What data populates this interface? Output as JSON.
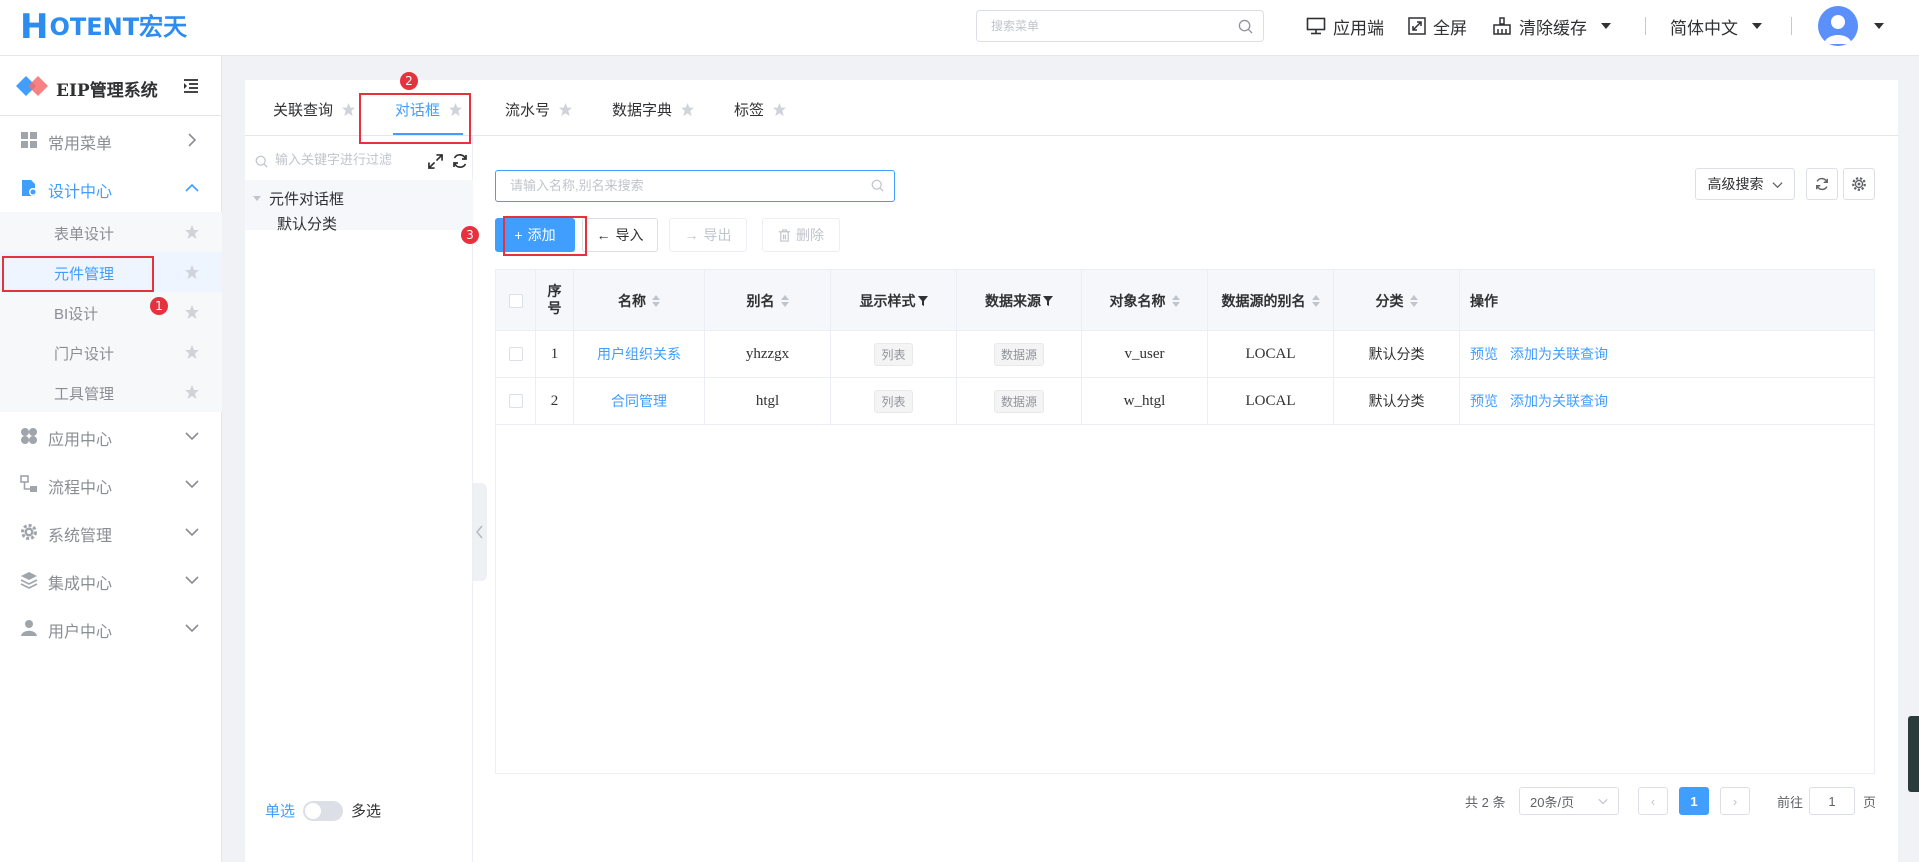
{
  "header": {
    "logo_h": "H",
    "logo_text": "OTENT宏天",
    "search_placeholder": "搜索菜单",
    "app_label": "应用端",
    "fullscreen_label": "全屏",
    "clear_cache_label": "清除缓存",
    "language_label": "简体中文"
  },
  "sidebar": {
    "system_name": "EIP管理系统",
    "menu": [
      {
        "label": "常用菜单"
      },
      {
        "label": "设计中心"
      },
      {
        "label": "应用中心"
      },
      {
        "label": "流程中心"
      },
      {
        "label": "系统管理"
      },
      {
        "label": "集成中心"
      },
      {
        "label": "用户中心"
      }
    ],
    "design_sub": [
      {
        "label": "表单设计"
      },
      {
        "label": "元件管理"
      },
      {
        "label": "BI设计"
      },
      {
        "label": "门户设计"
      },
      {
        "label": "工具管理"
      }
    ]
  },
  "tabs": [
    {
      "label": "关联查询"
    },
    {
      "label": "对话框"
    },
    {
      "label": "流水号"
    },
    {
      "label": "数据字典"
    },
    {
      "label": "标签"
    }
  ],
  "tree": {
    "filter_placeholder": "输入关键字进行过滤",
    "root": "元件对话框",
    "child": "默认分类",
    "single_label": "单选",
    "multi_label": "多选"
  },
  "main": {
    "search_placeholder": "请输入名称,别名来搜索",
    "advanced_search": "高级搜索",
    "buttons": {
      "add": "添加",
      "import": "导入",
      "export": "导出",
      "delete": "删除"
    }
  },
  "table": {
    "columns": [
      "序号",
      "名称",
      "别名",
      "显示样式",
      "数据来源",
      "对象名称",
      "数据源的别名",
      "分类",
      "操作"
    ],
    "rows": [
      {
        "index": "1",
        "name": "用户组织关系",
        "alias": "yhzzgx",
        "style": "列表",
        "source": "数据源",
        "object": "v_user",
        "ds_alias": "LOCAL",
        "category": "默认分类",
        "op_preview": "预览",
        "op_add": "添加为关联查询"
      },
      {
        "index": "2",
        "name": "合同管理",
        "alias": "htgl",
        "style": "列表",
        "source": "数据源",
        "object": "w_htgl",
        "ds_alias": "LOCAL",
        "category": "默认分类",
        "op_preview": "预览",
        "op_add": "添加为关联查询"
      }
    ]
  },
  "pagination": {
    "total": "共 2 条",
    "page_size": "20条/页",
    "current_page": "1",
    "goto_label": "前往",
    "goto_value": "1",
    "page_suffix": "页"
  },
  "annotations": {
    "a1": "1",
    "a2": "2",
    "a3": "3"
  },
  "colors": {
    "primary": "#409eff",
    "annotation": "#e5323e"
  }
}
